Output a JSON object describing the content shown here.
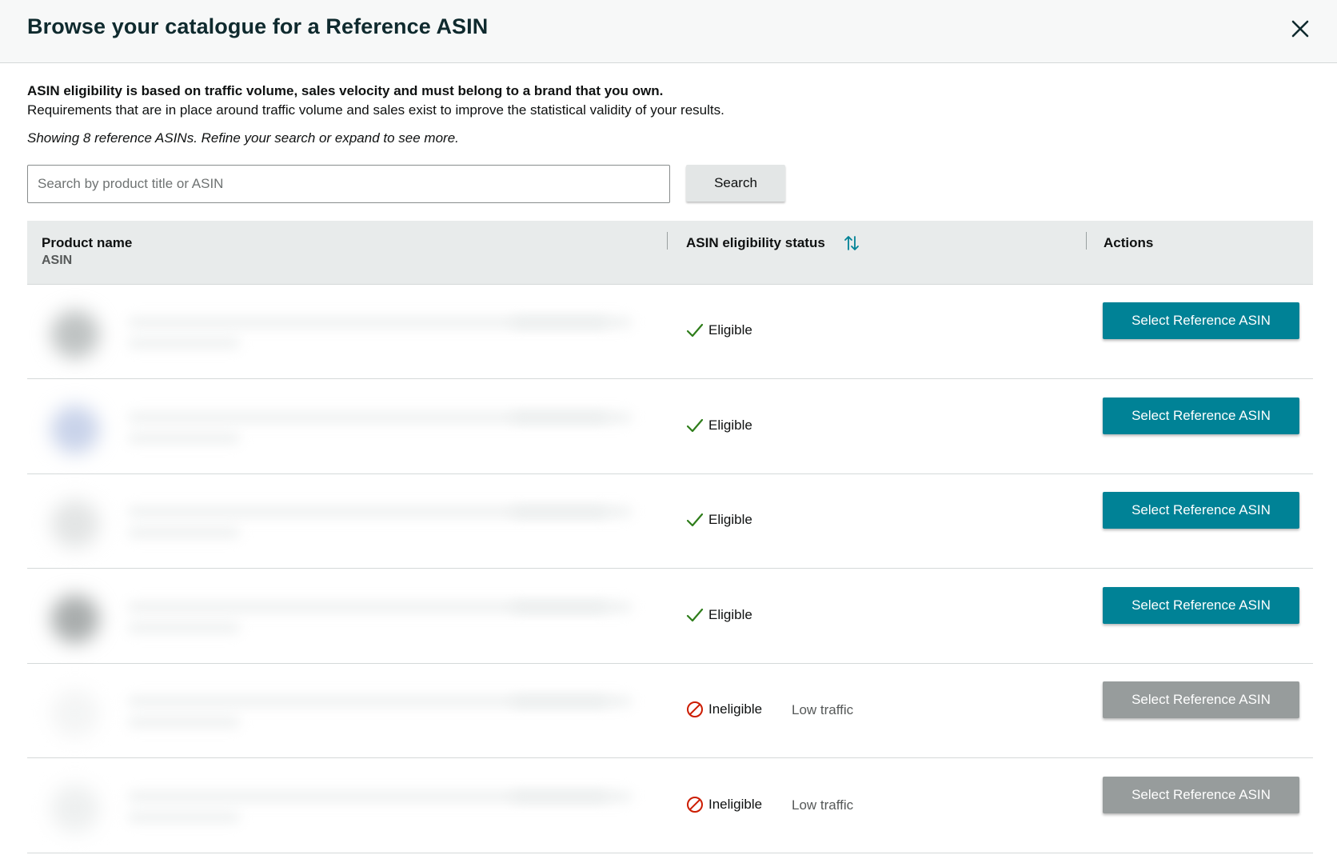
{
  "header": {
    "title": "Browse your catalogue for a Reference ASIN",
    "close_icon": "close-icon"
  },
  "description": {
    "bold": "ASIN eligibility is based on traffic volume, sales velocity and must belong to a brand that you own.",
    "normal": "Requirements that are in place around traffic volume and sales exist to improve the statistical validity of your results.",
    "showing": "Showing 8 reference ASINs. Refine your search or expand to see more."
  },
  "search": {
    "placeholder": "Search by product title or ASIN",
    "value": "",
    "button_label": "Search"
  },
  "table": {
    "columns": {
      "product_name": "Product name",
      "asin": "ASIN",
      "status": "ASIN eligibility status",
      "actions": "Actions"
    },
    "rows": [
      {
        "status": "Eligible",
        "eligible": true,
        "reason": "",
        "action_label": "Select Reference ASIN"
      },
      {
        "status": "Eligible",
        "eligible": true,
        "reason": "",
        "action_label": "Select Reference ASIN"
      },
      {
        "status": "Eligible",
        "eligible": true,
        "reason": "",
        "action_label": "Select Reference ASIN"
      },
      {
        "status": "Eligible",
        "eligible": true,
        "reason": "",
        "action_label": "Select Reference ASIN"
      },
      {
        "status": "Ineligible",
        "eligible": false,
        "reason": "Low traffic",
        "action_label": "Select Reference ASIN"
      },
      {
        "status": "Ineligible",
        "eligible": false,
        "reason": "Low traffic",
        "action_label": "Select Reference ASIN"
      }
    ]
  },
  "colors": {
    "primary_button": "#008296",
    "disabled_button": "#979c9c",
    "eligible_check": "#2e7d1a",
    "ineligible_icon": "#cc1c00",
    "sort_icon": "#008296"
  }
}
